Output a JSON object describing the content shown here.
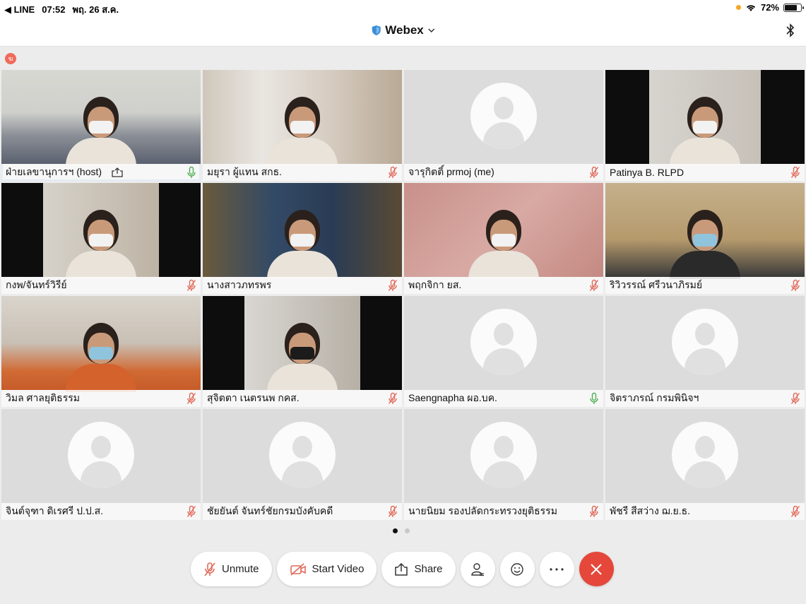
{
  "status_bar": {
    "back_app": "◀ LINE",
    "time": "07:52",
    "date": "พฤ. 26 ส.ค.",
    "battery": "72%",
    "battery_level": 0.72
  },
  "header": {
    "title": "Webex",
    "shield_color": "#3b8ed6"
  },
  "small_badge": "ฆ",
  "participants": [
    {
      "name": "ฝ่ายเลขานุการฯ (host)",
      "mic": "on",
      "video": "cam1",
      "active": true,
      "sharing": true
    },
    {
      "name": "มยุรา ผู้แทน สกธ.",
      "mic": "muted",
      "video": "cam2"
    },
    {
      "name": "จารุกิตติ์ prmoj (me)",
      "mic": "muted",
      "video": "avatar"
    },
    {
      "name": "Patinya B. RLPD",
      "mic": "muted",
      "video": "cam4"
    },
    {
      "name": "กงพ/จันทร์วิรีย์",
      "mic": "muted",
      "video": "cam5"
    },
    {
      "name": "นางสาวภทรพร",
      "mic": "muted",
      "video": "cam6"
    },
    {
      "name": "พฤกจิกา ยส.",
      "mic": "muted",
      "video": "cam7"
    },
    {
      "name": "ริวิวรรณ์ ศรีวนาภิรมย์",
      "mic": "muted",
      "video": "cam8"
    },
    {
      "name": "วิมล ศาลยุติธรรม",
      "mic": "muted",
      "video": "cam9"
    },
    {
      "name": "สุจิตตา เนตรนพ กคส.",
      "mic": "muted",
      "video": "cam10"
    },
    {
      "name": "Saengnapha ผอ.บค.",
      "mic": "on",
      "video": "avatar"
    },
    {
      "name": "จิตราภรณ์ กรมพินิจฯ",
      "mic": "muted",
      "video": "avatar"
    },
    {
      "name": "จินต์จุฑา ดิเรศรี ป.ป.ส.",
      "mic": "muted",
      "video": "avatar"
    },
    {
      "name": "ชัยยันต์ จันทร์ชัยกรมบังคับคดี",
      "mic": "muted",
      "video": "avatar"
    },
    {
      "name": "นายนิยม รองปลัดกระทรวงยุติธรรม",
      "mic": "muted",
      "video": "avatar"
    },
    {
      "name": "พัชรี สีสว่าง ฌ.ย.ธ.",
      "mic": "muted",
      "video": "avatar"
    }
  ],
  "pager": {
    "current": 1,
    "total": 2
  },
  "controls": {
    "unmute": "Unmute",
    "start_video": "Start Video",
    "share": "Share",
    "participants_icon": "participants-icon",
    "reactions_icon": "smiley-icon",
    "more_icon": "more-icon",
    "end_icon": "close-icon"
  },
  "colors": {
    "muted": "#e06a5a",
    "active_mic": "#4caf50",
    "active_border": "#3d8fd6",
    "end_call": "#e5483a"
  }
}
